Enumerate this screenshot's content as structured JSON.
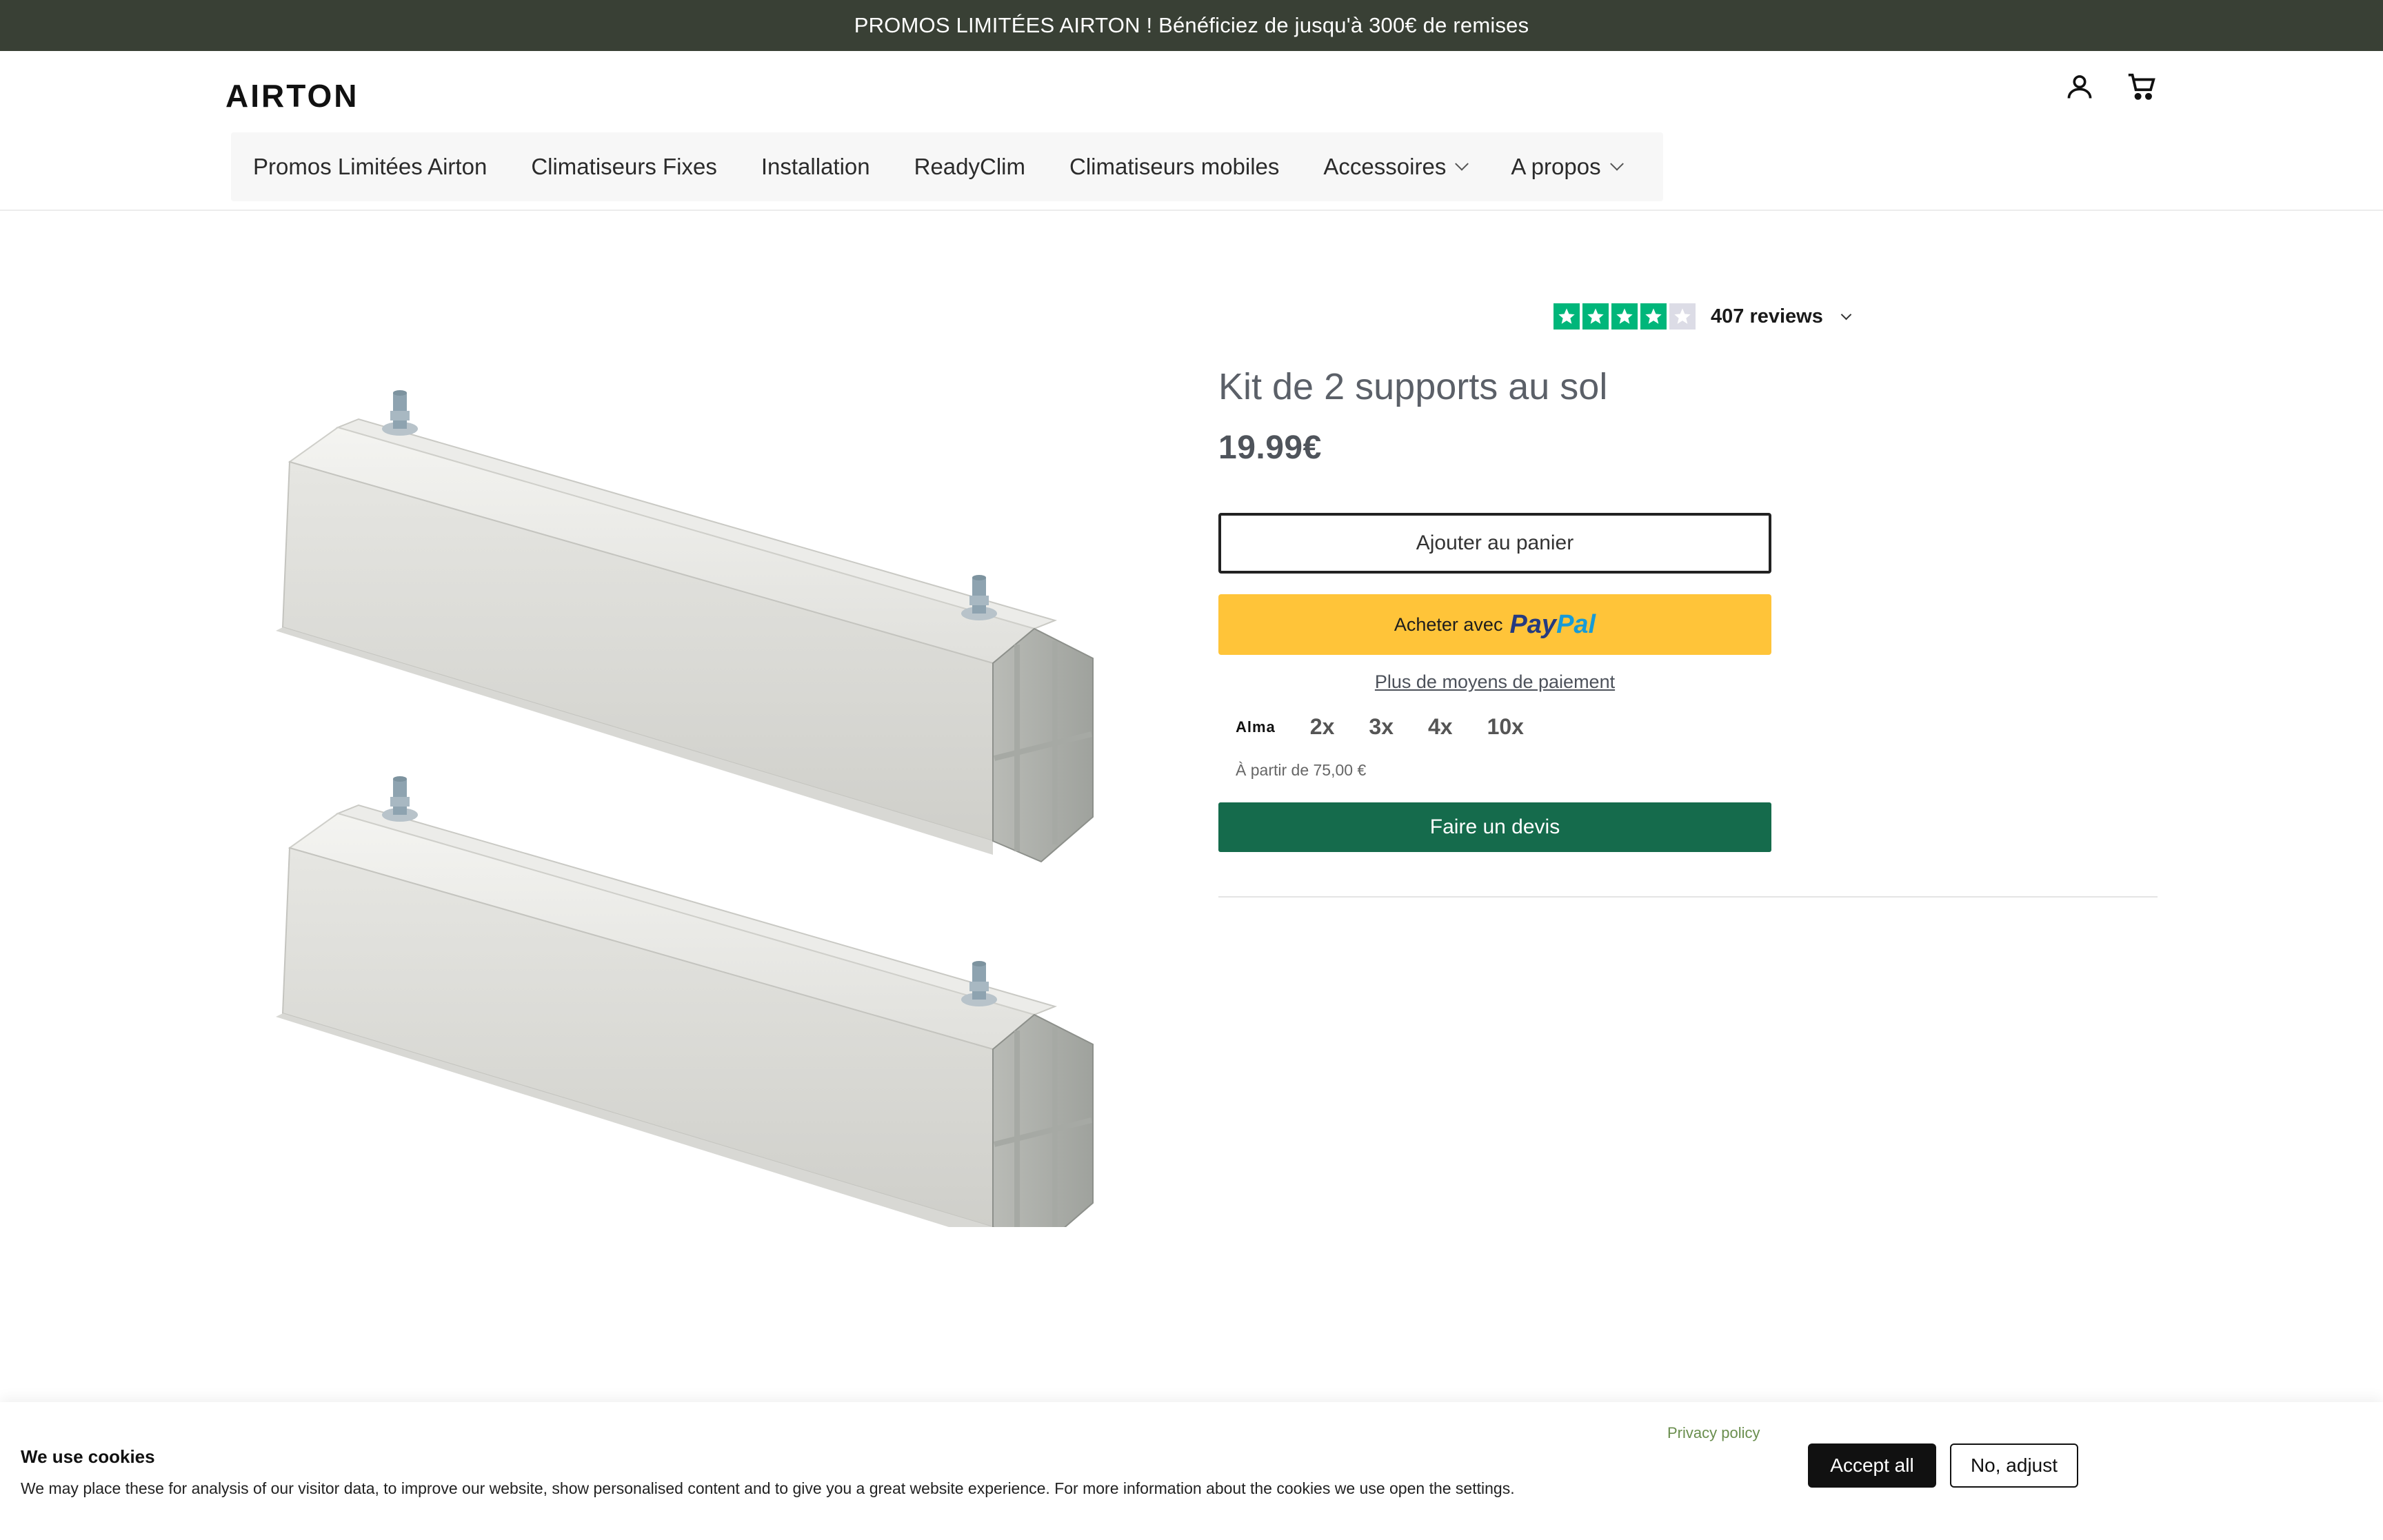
{
  "announcement": {
    "text": "PROMOS LIMITÉES AIRTON ! Bénéficiez de jusqu'à 300€ de remises"
  },
  "header": {
    "logo": "AIRTON",
    "icons": [
      "account-icon",
      "cart-icon"
    ]
  },
  "nav": {
    "items": [
      {
        "label": "Promos Limitées Airton",
        "dropdown": false
      },
      {
        "label": "Climatiseurs Fixes",
        "dropdown": false
      },
      {
        "label": "Installation",
        "dropdown": false
      },
      {
        "label": "ReadyClim",
        "dropdown": false
      },
      {
        "label": "Climatiseurs mobiles",
        "dropdown": false
      },
      {
        "label": "Accessoires",
        "dropdown": true
      },
      {
        "label": "A propos",
        "dropdown": true
      }
    ]
  },
  "reviews": {
    "rating_stars": 4,
    "max_stars": 5,
    "label": "407 reviews",
    "star_color": "#00b67a"
  },
  "product": {
    "title": "Kit de 2 supports au sol",
    "price": "19.99€",
    "image_alt": "product-image"
  },
  "buttons": {
    "add_to_cart": "Ajouter au panier",
    "paypal_prefix": "Acheter avec",
    "paypal_brand_1": "Pay",
    "paypal_brand_2": "Pal",
    "more_payment": "Plus de moyens de paiement",
    "quote": "Faire un devis"
  },
  "alma": {
    "logo": "Alma",
    "options": [
      "2x",
      "3x",
      "4x",
      "10x"
    ],
    "note": "À partir de 75,00 €"
  },
  "cookie": {
    "title": "We use cookies",
    "text": "We may place these for analysis of our visitor data, to improve our website, show personalised content and to give you a great website experience. For more information about the cookies we use open the settings.",
    "privacy": "Privacy policy",
    "accept": "Accept all",
    "adjust": "No, adjust"
  },
  "colors": {
    "announcement_bg": "#394035",
    "paypal_bg": "#ffc439",
    "quote_bg": "#156b4c",
    "trustpilot": "#00b67a"
  }
}
